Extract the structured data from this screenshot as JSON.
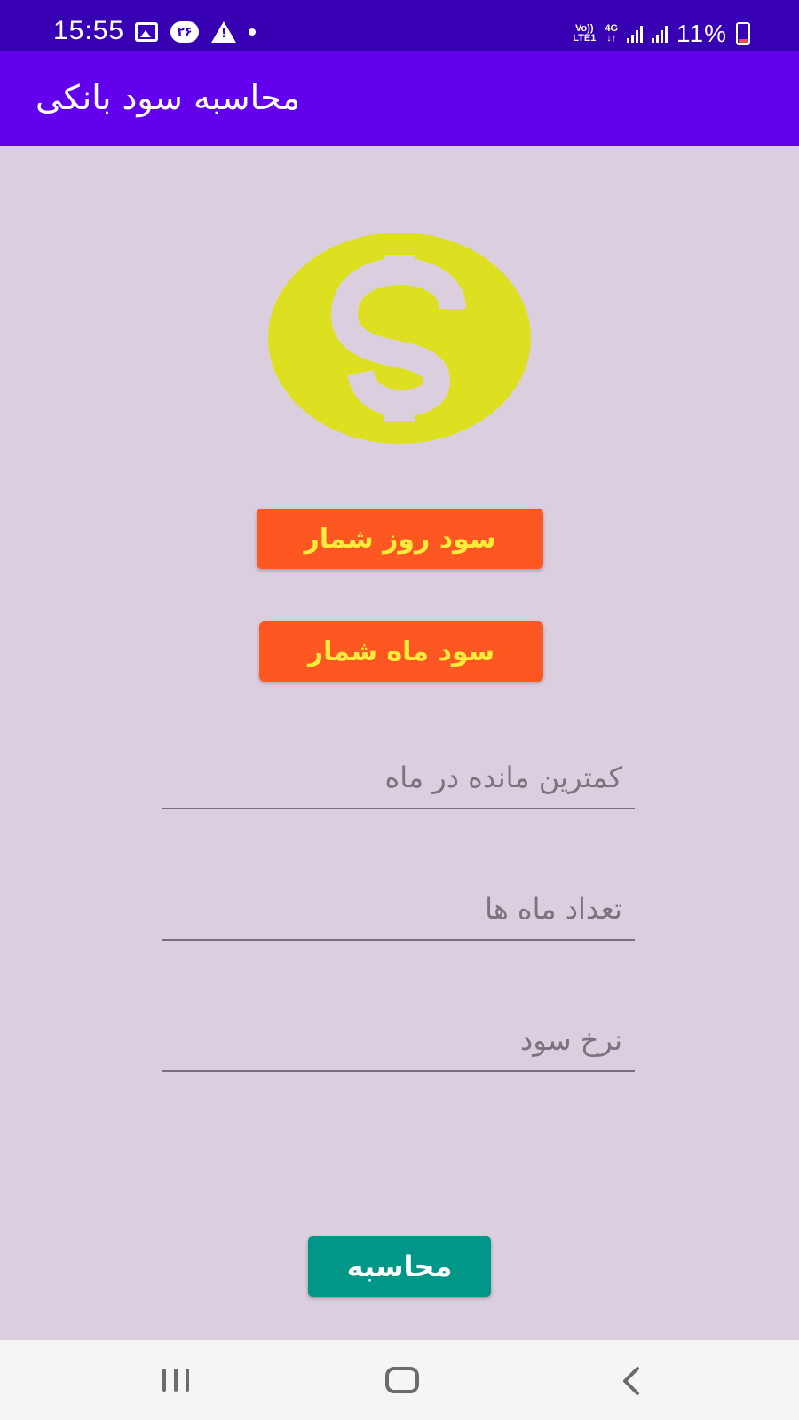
{
  "status_bar": {
    "time": "15:55",
    "notification_badge": "۲۶",
    "warning_mark": "!",
    "net_volte": "Vo))",
    "net_lte": "LTE1",
    "net_4g": "4G",
    "net_arrows": "↓↑",
    "battery": "11%",
    "icons": [
      "image-icon",
      "notification-badge-icon",
      "warning-icon",
      "dot-icon",
      "signal-icon",
      "battery-icon"
    ]
  },
  "app_bar": {
    "title": "محاسبه سود بانکی"
  },
  "main": {
    "logo_icon": "dollar-coin-icon",
    "btn_daily": "سود روز شمار",
    "btn_monthly": "سود ماه شمار",
    "field_min_balance_placeholder": "کمترین مانده در ماه",
    "field_months_placeholder": "تعداد ماه ها",
    "field_rate_placeholder": "نرخ سود",
    "calc_button": "محاسبه"
  },
  "nav_bar": {
    "icons": [
      "recents-icon",
      "home-icon",
      "back-icon"
    ]
  },
  "colors": {
    "status_bar": "#3700b3",
    "app_bar": "#6200ee",
    "background": "#dbcfdf",
    "coin": "#dde021",
    "orange_button": "#ff5722",
    "orange_button_text": "#ffeb3b",
    "calc_button": "#009688"
  }
}
